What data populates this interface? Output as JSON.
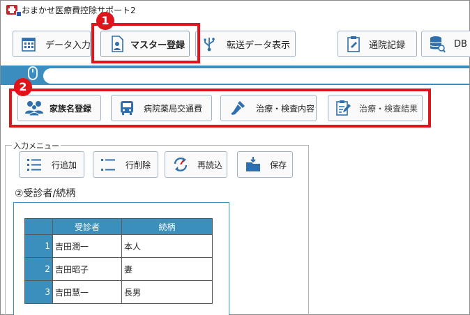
{
  "window": {
    "title": "おまかせ医療費控除サポート2"
  },
  "toolbar": {
    "items": [
      {
        "label": "データ入力",
        "icon": "calendar-grid-icon"
      },
      {
        "label": "マスター登録",
        "icon": "person-document-icon"
      },
      {
        "label": "転送データ表示",
        "icon": "usb-icon"
      },
      {
        "label": "通院記録",
        "icon": "clipboard-icon"
      },
      {
        "label": "DB",
        "icon": "database-search-icon"
      }
    ]
  },
  "callouts": {
    "one": "1",
    "two": "2"
  },
  "master_tabs": [
    {
      "label": "家族名登録",
      "icon": "family-icon"
    },
    {
      "label": "病院薬局交通費",
      "icon": "bus-icon"
    },
    {
      "label": "治療・検査内容",
      "icon": "dropper-icon"
    },
    {
      "label": "治療・検査結果",
      "icon": "report-pen-icon"
    }
  ],
  "input_menu": {
    "title": "入力メニュー",
    "buttons": [
      {
        "label": "行追加",
        "icon": "list-add-icon"
      },
      {
        "label": "行削除",
        "icon": "list-delete-icon"
      },
      {
        "label": "再読込",
        "icon": "reload-icon"
      },
      {
        "label": "保存",
        "icon": "save-folder-icon"
      }
    ]
  },
  "section_title": "②受診者/続柄",
  "table": {
    "headers": [
      "受診者",
      "続柄"
    ],
    "rows": [
      {
        "no": "1",
        "name": "吉田潤一",
        "relation": "本人"
      },
      {
        "no": "2",
        "name": "吉田昭子",
        "relation": "妻"
      },
      {
        "no": "3",
        "name": "吉田慧一",
        "relation": "長男"
      }
    ]
  },
  "colors": {
    "accent_blue": "#3c8dbf",
    "highlight_red": "#e0141b"
  }
}
